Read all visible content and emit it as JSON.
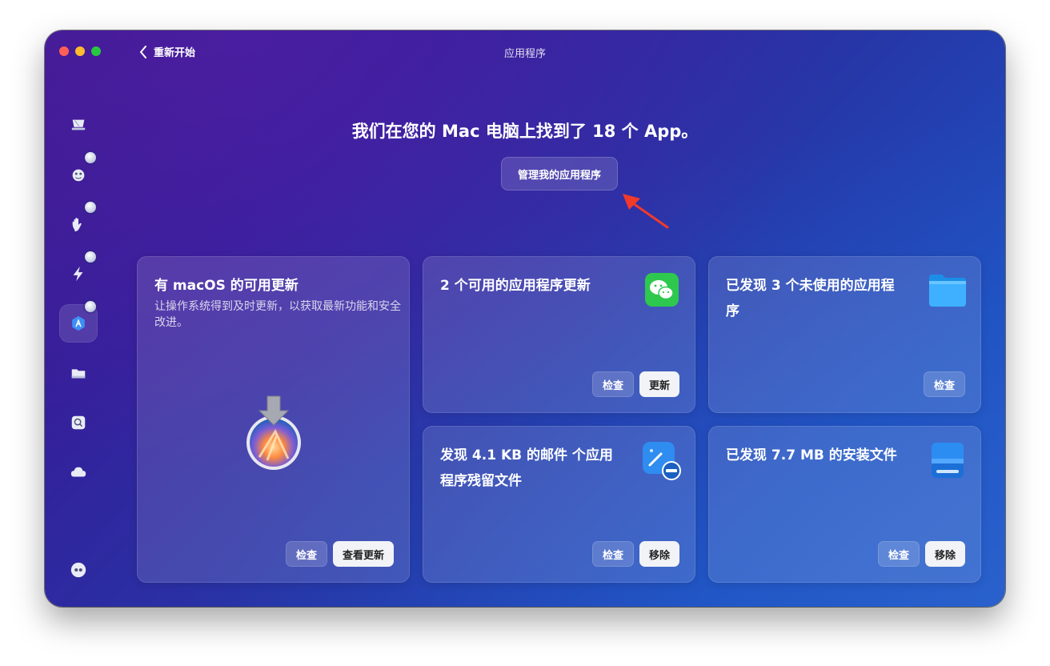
{
  "window": {
    "title": "应用程序",
    "back_label": "重新开始"
  },
  "headline": "我们在您的 Mac 电脑上找到了 18 个 App。",
  "manage_button": "管理我的应用程序",
  "sidebar": {
    "items": [
      {
        "icon": "cleanup-icon",
        "badge": false,
        "active": false
      },
      {
        "icon": "protection-icon",
        "badge": true,
        "active": false
      },
      {
        "icon": "privacy-hand-icon",
        "badge": true,
        "active": false
      },
      {
        "icon": "performance-bolt-icon",
        "badge": true,
        "active": false
      },
      {
        "icon": "applications-icon",
        "badge": true,
        "active": true
      },
      {
        "icon": "my-clutter-icon",
        "badge": false,
        "active": false
      },
      {
        "icon": "space-lens-icon",
        "badge": false,
        "active": false
      },
      {
        "icon": "cloud-icon",
        "badge": false,
        "active": false
      },
      {
        "icon": "assistant-icon",
        "badge": false,
        "active": false
      }
    ]
  },
  "cards": {
    "macos_update": {
      "title": "有 macOS 的可用更新",
      "desc": "让操作系统得到及时更新，以获取最新功能和安全改进。",
      "check_label": "检查",
      "action_label": "查看更新"
    },
    "app_updates": {
      "title": "2 个可用的应用程序更新",
      "check_label": "检查",
      "action_label": "更新"
    },
    "unused_apps": {
      "title_line1": "已发现 3 个未使用的应用程",
      "title_line2": "序",
      "check_label": "检查"
    },
    "leftovers": {
      "title_line1": "发现 4.1 KB 的邮件 个应用",
      "title_line2": "程序残留文件",
      "check_label": "检查",
      "action_label": "移除"
    },
    "installers": {
      "title": "已发现 7.7 MB 的安装文件",
      "check_label": "检查",
      "action_label": "移除"
    }
  },
  "colors": {
    "accent_arrow": "#f23a2a",
    "window_gradient_start": "#3a1a8c",
    "window_gradient_end": "#2a5ac4"
  }
}
